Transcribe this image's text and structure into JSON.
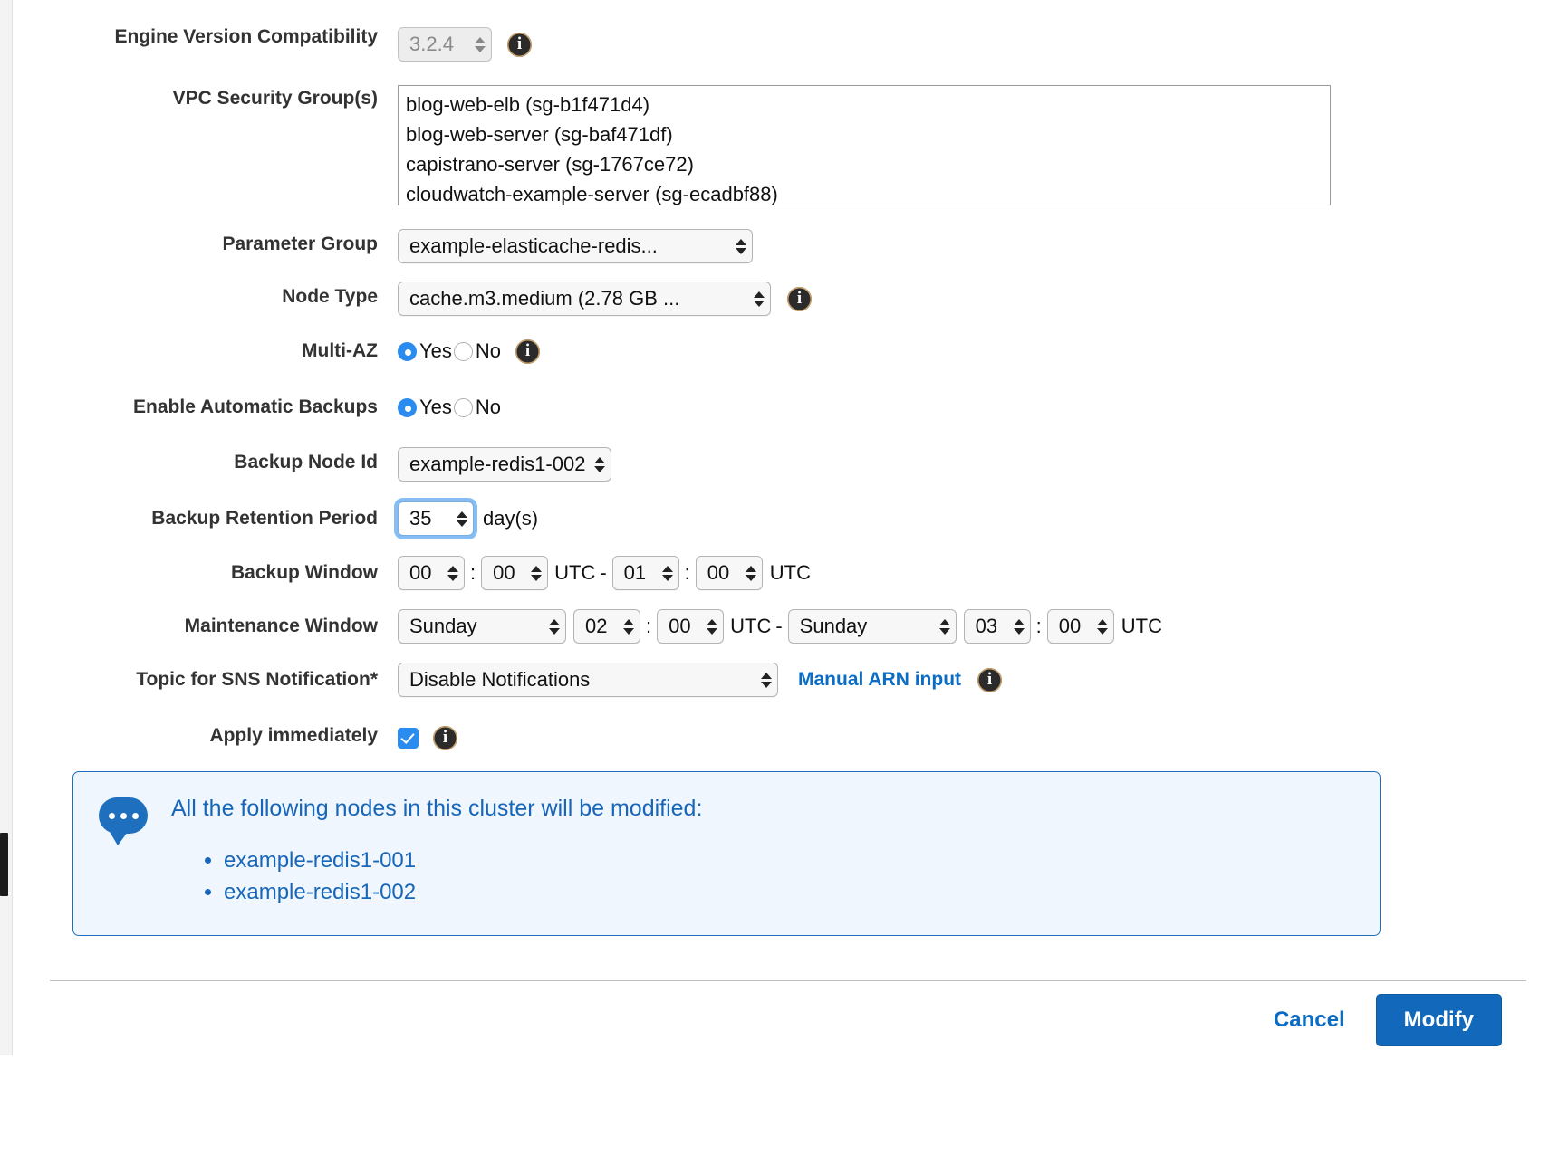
{
  "form": {
    "engine_version": {
      "label": "Engine Version Compatibility",
      "value": "3.2.4",
      "info_icon": "info-icon"
    },
    "vpc_security_groups": {
      "label": "VPC Security Group(s)",
      "options": [
        "blog-web-elb (sg-b1f471d4)",
        "blog-web-server (sg-baf471df)",
        "capistrano-server (sg-1767ce72)",
        "cloudwatch-example-server (sg-ecadbf88)"
      ]
    },
    "parameter_group": {
      "label": "Parameter Group",
      "value": "example-elasticache-redis..."
    },
    "node_type": {
      "label": "Node Type",
      "value": "cache.m3.medium (2.78 GB ...",
      "info_icon": "info-icon"
    },
    "multi_az": {
      "label": "Multi-AZ",
      "yes_label": "Yes",
      "no_label": "No",
      "selected": "Yes",
      "info_icon": "info-icon"
    },
    "automatic_backups": {
      "label": "Enable Automatic Backups",
      "yes_label": "Yes",
      "no_label": "No",
      "selected": "Yes"
    },
    "backup_node_id": {
      "label": "Backup Node Id",
      "value": "example-redis1-002"
    },
    "backup_retention": {
      "label": "Backup Retention Period",
      "value": "35",
      "unit": "day(s)"
    },
    "backup_window": {
      "label": "Backup Window",
      "start_hour": "00",
      "start_minute": "00",
      "start_tz": "UTC",
      "dash": "-",
      "end_hour": "01",
      "end_minute": "00",
      "end_tz": "UTC",
      "colon": ":"
    },
    "maintenance_window": {
      "label": "Maintenance Window",
      "start_day": "Sunday",
      "start_hour": "02",
      "start_minute": "00",
      "start_tz": "UTC",
      "dash": "-",
      "end_day": "Sunday",
      "end_hour": "03",
      "end_minute": "00",
      "end_tz": "UTC",
      "colon": ":"
    },
    "sns_topic": {
      "label": "Topic for SNS Notification*",
      "value": "Disable Notifications",
      "manual_arn_link": "Manual ARN input",
      "info_icon": "info-icon"
    },
    "apply_immediately": {
      "label": "Apply immediately",
      "checked": true,
      "info_icon": "info-icon"
    }
  },
  "callout": {
    "icon": "speech-bubble-icon",
    "title": "All the following nodes in this cluster will be modified:",
    "nodes": [
      "example-redis1-001",
      "example-redis1-002"
    ]
  },
  "footer": {
    "cancel_label": "Cancel",
    "modify_label": "Modify"
  },
  "colors": {
    "accent_blue": "#1268bb",
    "link_blue": "#0a6cc4",
    "radio_blue": "#2b8cf0",
    "callout_bg": "#eff6fd",
    "callout_border": "#1f6fbf",
    "callout_text": "#1766b8"
  }
}
